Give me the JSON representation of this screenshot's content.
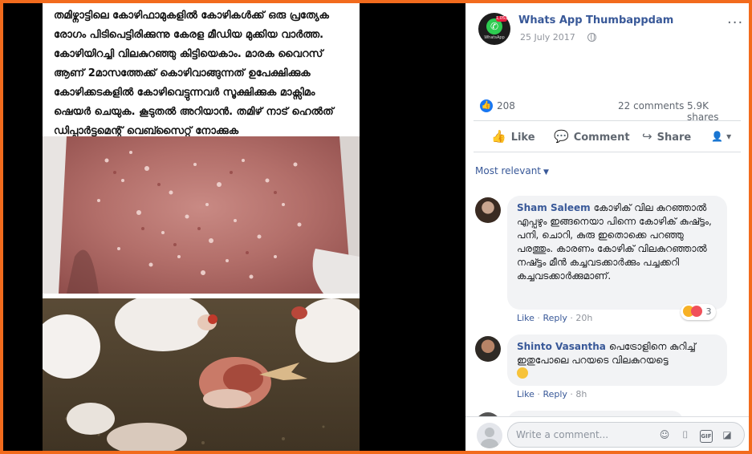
{
  "post_image": {
    "malayalam_text": "തമിഴ്നാട്ടിലെ കോഴിഫാമുകളിൽ കോഴികൾക്ക് ഒരു പ്രത്യേക  രോഗം പിടിപെട്ടിരിക്കുന്നു  കേരള മീഡിയ മുക്കിയ വാർത്ത. കോഴിയിറച്ചി വിലകുറഞ്ഞു കിട്ടിയെകാം. മാരക വൈറസ് ആണ് 2മാസത്തേക്ക് കൊഴിവാങ്ങുന്നത് ഉപേക്ഷിക്കുക കോഴിക്കടകളിൽ കോഴിവെട്ടുന്നവർ സൂക്ഷിക്കുക മാക്സിമം ഷെയർ ചെയുക. കൂടുതൽ അറിയാൻ. തമിഴ് നാട്  ഹെൽത് ഡിപ്പാർട്ടമെന്റ് വെബ്സൈറ്റ് നോക്കുക"
  },
  "header": {
    "page_name": "Whats App Thumbappdam",
    "date": "25 July 2017",
    "avatar_badge": "1,053",
    "avatar_caption": "WhatsApp",
    "more_icon": "···"
  },
  "stats": {
    "reactions": "208",
    "comments": "22 comments",
    "shares": "5.9K shares"
  },
  "actions": {
    "like": "Like",
    "comment": "Comment",
    "share": "Share"
  },
  "sort": {
    "label": "Most relevant"
  },
  "comments": [
    {
      "author": "Sham Saleem",
      "text": "കോഴിക് വില കുറഞ്ഞാൽ എപ്പഴും ഇങ്ങനെയാ പിന്നെ കോഴിക് കുഷ്ട്ടം, പനി, ചൊറി, കുരു ഇതൊക്കെ പറഞ്ഞു പരത്തും. കാരണം കോഴിക് വിലകുറഞ്ഞാൽ നഷ്ട്ടം മീൻ കച്ചവടക്കാർക്കും പച്ചക്കറി കച്ചവടക്കാർക്കുമാണ്.",
      "like": "Like",
      "reply": "Reply",
      "time": "20h",
      "reaction_count": "3"
    },
    {
      "author": "Shinto Vasantha",
      "text": "പെട്രോളിനെ കുറിച്ച് ഇതുപോലെ പറയടെ വിലകുറയട്ടെ",
      "like": "Like",
      "reply": "Reply",
      "time": "8h"
    }
  ],
  "composer": {
    "placeholder": "Write a comment..."
  },
  "colors": {
    "frame": "#f26b1d",
    "link": "#385898",
    "like_blue": "#1877f2"
  }
}
